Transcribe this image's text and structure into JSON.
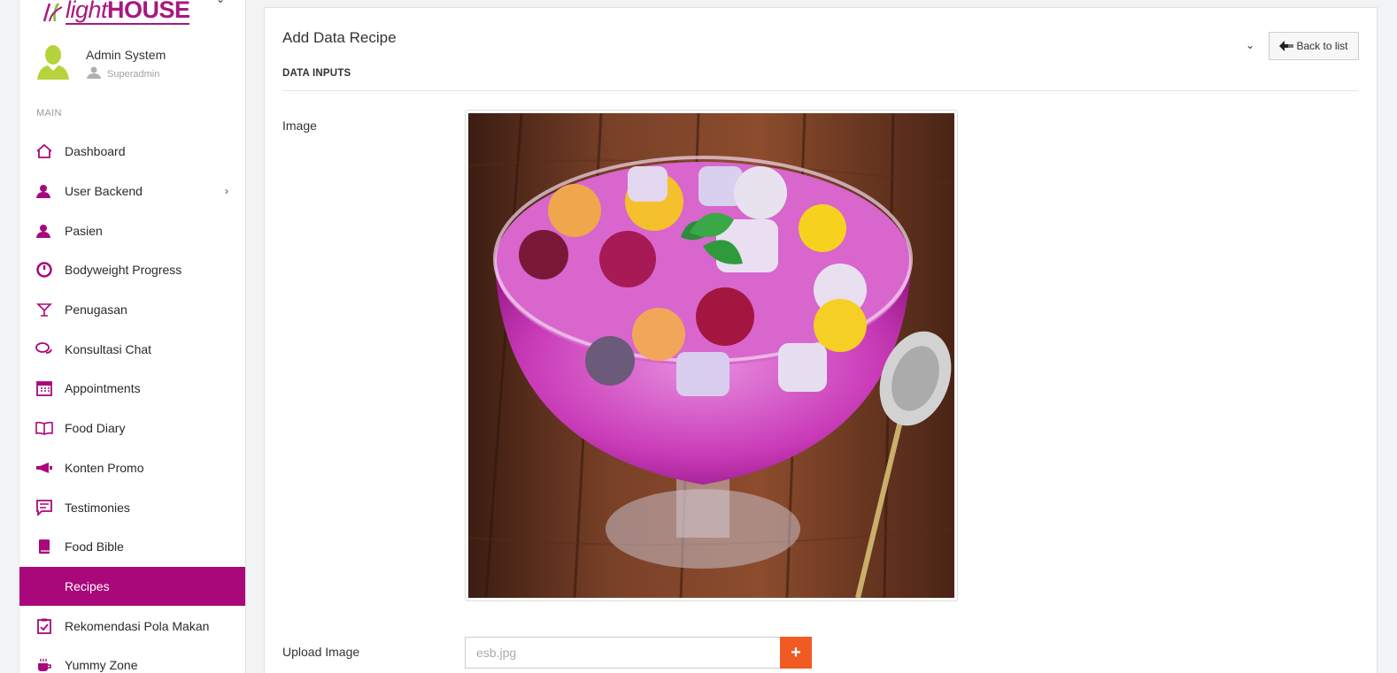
{
  "brand": {
    "logo_light": "light",
    "logo_house": "HOUSE",
    "color": "#a8187f"
  },
  "user": {
    "name": "Admin System",
    "role": "Superadmin"
  },
  "sidebar": {
    "section_label": "MAIN",
    "items": [
      {
        "label": "Dashboard",
        "icon": "home-icon"
      },
      {
        "label": "User Backend",
        "icon": "user-icon",
        "has_submenu": true
      },
      {
        "label": "Pasien",
        "icon": "user-icon"
      },
      {
        "label": "Bodyweight Progress",
        "icon": "gauge-icon"
      },
      {
        "label": "Penugasan",
        "icon": "tasks-icon"
      },
      {
        "label": "Konsultasi Chat",
        "icon": "chat-icon"
      },
      {
        "label": "Appointments",
        "icon": "calendar-icon"
      },
      {
        "label": "Food Diary",
        "icon": "book-open-icon"
      },
      {
        "label": "Konten Promo",
        "icon": "megaphone-icon"
      },
      {
        "label": "Testimonies",
        "icon": "comment-icon"
      },
      {
        "label": "Food Bible",
        "icon": "book-icon"
      },
      {
        "label": "Recipes",
        "icon": "recipe-icon",
        "active": true
      },
      {
        "label": "Rekomendasi Pola Makan",
        "icon": "clipboard-check-icon"
      },
      {
        "label": "Yummy Zone",
        "icon": "coffee-icon"
      }
    ],
    "active_color": "#a8087a"
  },
  "main": {
    "title": "Add Data Recipe",
    "back_button": "Back to list",
    "section": "DATA INPUTS",
    "fields": {
      "image_label": "Image",
      "upload_label": "Upload Image",
      "upload_value": "esb.jpg"
    },
    "accent": "#f15a22"
  }
}
